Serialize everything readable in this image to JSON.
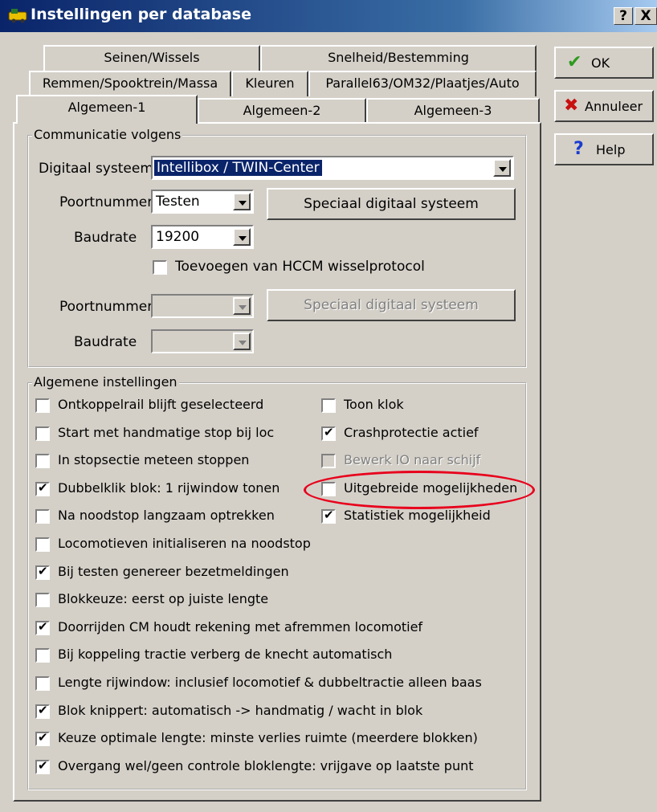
{
  "window": {
    "title": "Instellingen per database",
    "help_btn": "?",
    "close_btn": "X"
  },
  "tabs": {
    "row1": [
      "Seinen/Wissels",
      "Snelheid/Bestemming"
    ],
    "row2": [
      "Remmen/Spooktrein/Massa",
      "Kleuren",
      "Parallel63/OM32/Plaatjes/Auto"
    ],
    "row3": [
      "Algemeen-1",
      "Algemeen-2",
      "Algemeen-3"
    ],
    "active": "Algemeen-1"
  },
  "side_buttons": {
    "ok": "OK",
    "cancel": "Annuleer",
    "help": "Help"
  },
  "communication": {
    "group_label": "Communicatie volgens",
    "digital_system_label": "Digitaal systeem",
    "digital_system_value": "Intellibox / TWIN-Center",
    "port1_label": "Poortnummer",
    "port1_value": "Testen",
    "special1_button": "Speciaal digitaal systeem",
    "baud1_label": "Baudrate",
    "baud1_value": "19200",
    "hccm_label": "Toevoegen van HCCM wisselprotocol",
    "hccm_checked": false,
    "port2_label": "Poortnummer",
    "port2_value": "",
    "special2_button": "Speciaal digitaal systeem",
    "baud2_label": "Baudrate",
    "baud2_value": ""
  },
  "general": {
    "group_label": "Algemene instellingen",
    "left_options": [
      {
        "label": "Ontkoppelrail blijft geselecteerd",
        "checked": false
      },
      {
        "label": "Start met handmatige stop bij loc",
        "checked": false
      },
      {
        "label": "In stopsectie meteen stoppen",
        "checked": false
      },
      {
        "label": "Dubbelklik blok: 1 rijwindow tonen",
        "checked": true
      },
      {
        "label": "Na noodstop langzaam optrekken",
        "checked": false
      },
      {
        "label": "Locomotieven initialiseren na noodstop",
        "checked": false
      },
      {
        "label": "Bij testen genereer bezetmeldingen",
        "checked": true
      },
      {
        "label": "Blokkeuze: eerst op juiste lengte",
        "checked": false
      },
      {
        "label": "Doorrijden CM houdt rekening met afremmen locomotief",
        "checked": true
      },
      {
        "label": "Bij koppeling tractie verberg de knecht automatisch",
        "checked": false
      },
      {
        "label": "Lengte rijwindow: inclusief locomotief & dubbeltractie alleen baas",
        "checked": false
      },
      {
        "label": "Blok knippert: automatisch -> handmatig / wacht in blok",
        "checked": true
      },
      {
        "label": "Keuze optimale lengte: minste verlies ruimte (meerdere blokken)",
        "checked": true
      },
      {
        "label": "Overgang wel/geen controle bloklengte: vrijgave op laatste punt",
        "checked": true
      }
    ],
    "right_options": [
      {
        "label": "Toon klok",
        "checked": false,
        "disabled": false
      },
      {
        "label": "Crashprotectie actief",
        "checked": true,
        "disabled": false
      },
      {
        "label": "Bewerk IO naar schijf",
        "checked": false,
        "disabled": true
      },
      {
        "label": "Uitgebreide mogelijkheden",
        "checked": false,
        "disabled": false
      },
      {
        "label": "Statistiek mogelijkheid",
        "checked": true,
        "disabled": false
      }
    ]
  },
  "colors": {
    "title_bar": "#0a246a",
    "highlight_ellipse": "#e8001c",
    "ok_check": "#2d9a1e",
    "cancel_x": "#c81010",
    "help_q": "#1a3ccf"
  }
}
